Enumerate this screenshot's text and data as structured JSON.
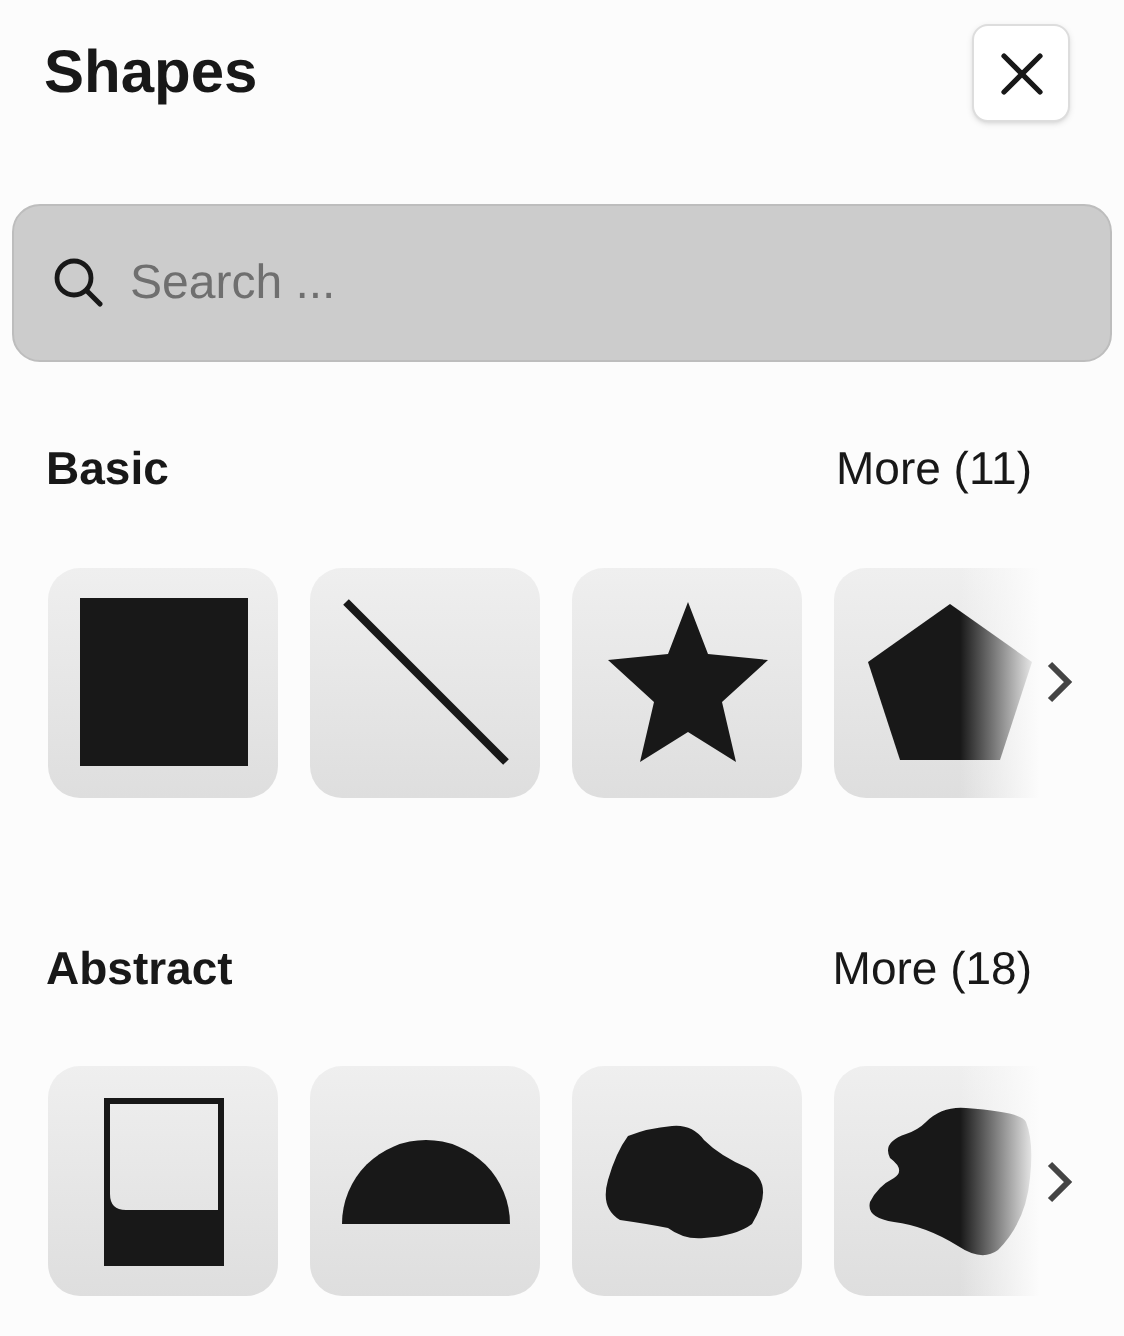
{
  "title": "Shapes",
  "search": {
    "placeholder": "Search ..."
  },
  "sections": [
    {
      "title": "Basic",
      "more": "More (11)",
      "shapes": [
        {
          "kind": "square"
        },
        {
          "kind": "line"
        },
        {
          "kind": "star"
        },
        {
          "kind": "pentagon"
        }
      ]
    },
    {
      "title": "Abstract",
      "more": "More (18)",
      "shapes": [
        {
          "kind": "frame"
        },
        {
          "kind": "half-circle"
        },
        {
          "kind": "blob"
        },
        {
          "kind": "blob2"
        }
      ]
    }
  ]
}
